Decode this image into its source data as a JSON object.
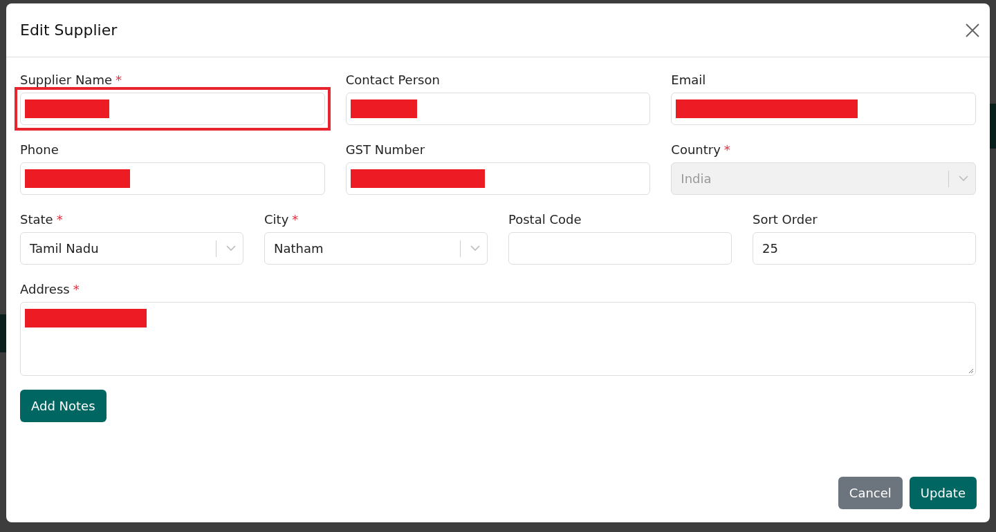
{
  "dialog": {
    "title": "Edit Supplier",
    "rows": [
      [
        {
          "kind": "text",
          "label": "Supplier Name",
          "required_mark": "*",
          "redacted": true,
          "highlighted": true
        },
        {
          "kind": "text",
          "label": "Contact Person",
          "redacted": true,
          "highlighted": false
        },
        {
          "kind": "text",
          "label": "Email",
          "redacted": true,
          "highlighted": false
        }
      ],
      [
        {
          "kind": "text",
          "label": "Phone",
          "redacted": true,
          "highlighted": false
        },
        {
          "kind": "text",
          "label": "GST Number",
          "redacted": true,
          "highlighted": false
        },
        {
          "kind": "select",
          "label": "Country",
          "required_mark": "*",
          "value": "India",
          "disabled": true,
          "highlighted": false
        }
      ],
      [
        {
          "kind": "select",
          "label": "State",
          "required_mark": "*",
          "value": "Tamil Nadu",
          "disabled": false,
          "highlighted": false
        },
        {
          "kind": "select",
          "label": "City",
          "required_mark": "*",
          "value": "Natham",
          "disabled": false,
          "highlighted": false
        },
        {
          "kind": "text",
          "label": "Postal Code",
          "redacted": false,
          "highlighted": false
        },
        {
          "kind": "text",
          "label": "Sort Order",
          "value": "25",
          "redacted": false,
          "highlighted": false
        }
      ],
      [
        {
          "kind": "textarea",
          "label": "Address",
          "required_mark": "*",
          "redacted": true,
          "highlighted": false
        }
      ]
    ],
    "add_notes": "Add Notes",
    "buttons": [
      {
        "kind": "secondary",
        "label": "Cancel"
      },
      {
        "kind": "primary",
        "label": "Update"
      }
    ]
  }
}
